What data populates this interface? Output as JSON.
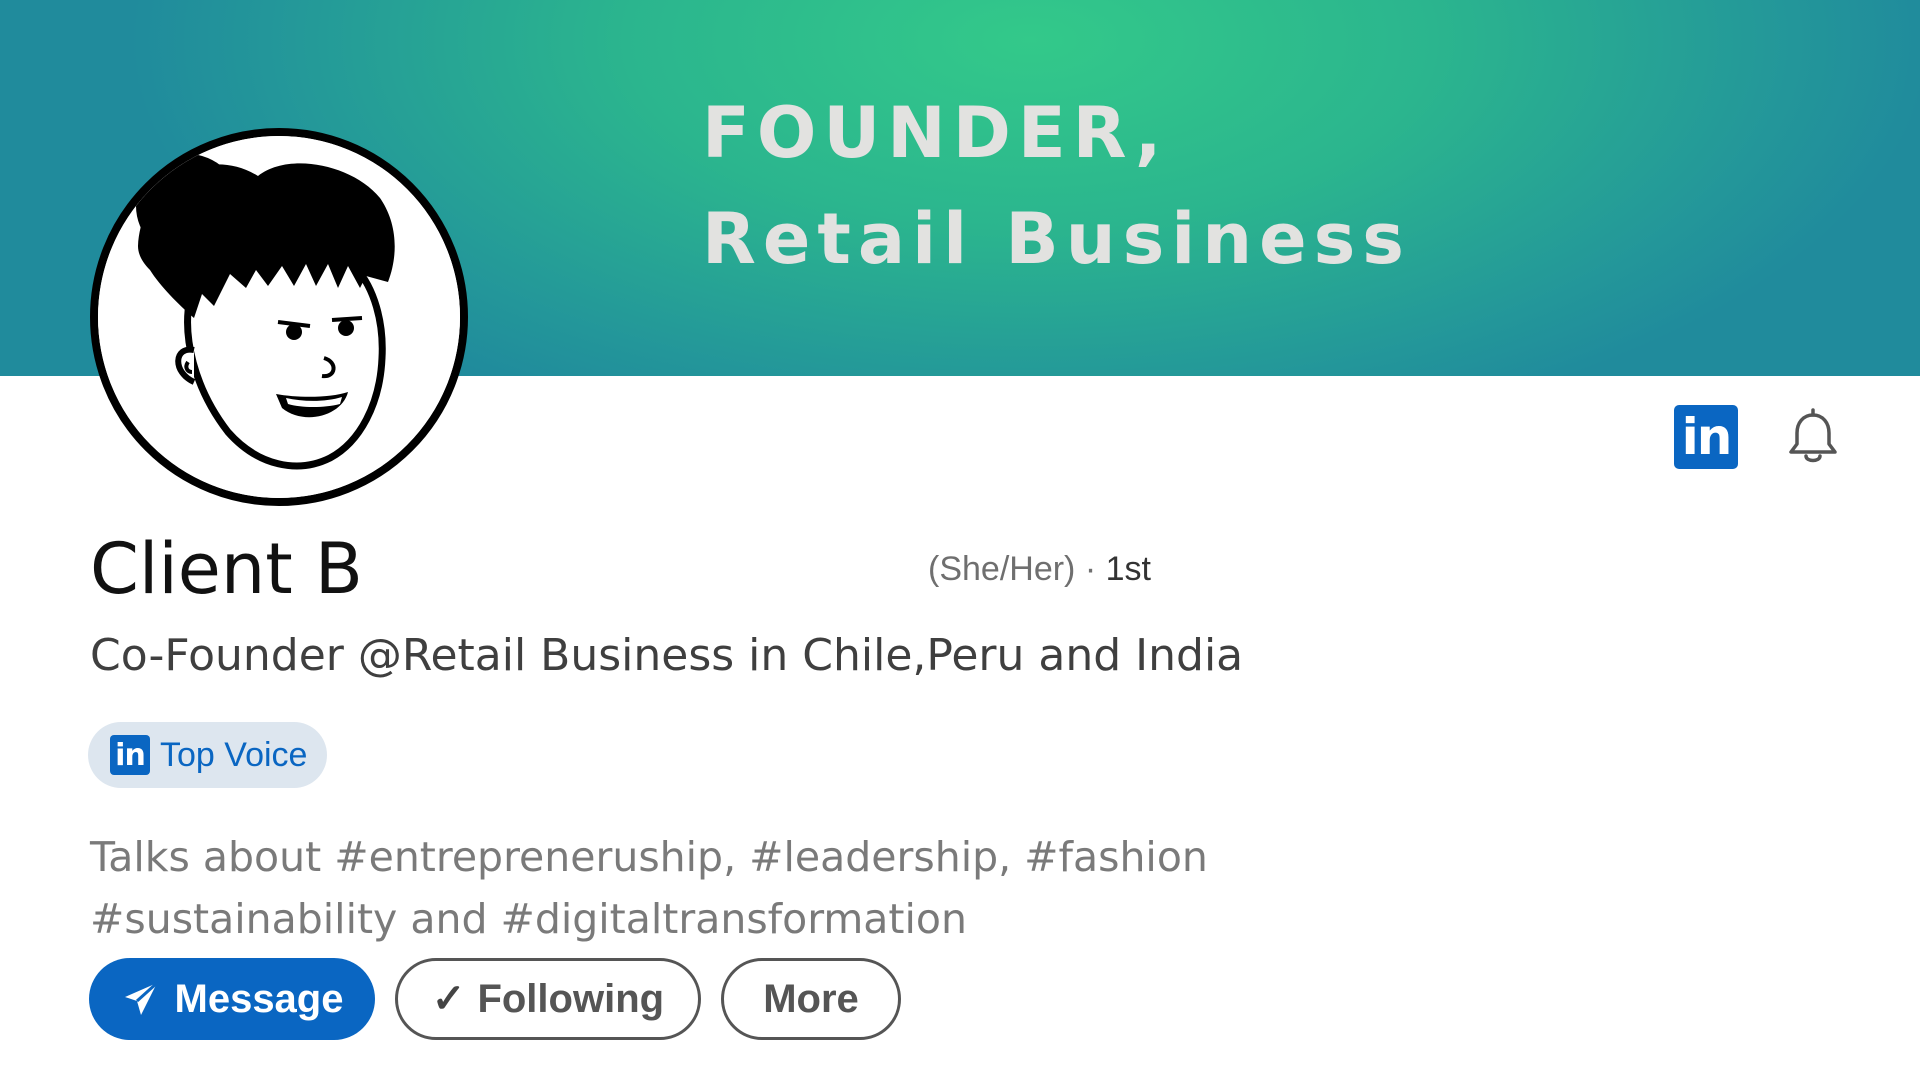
{
  "banner": {
    "line1": "FOUNDER,",
    "line2": "Retail Business"
  },
  "profile": {
    "name": "Client B",
    "pronouns": "(She/Her)",
    "separator": " · ",
    "degree": "1st",
    "headline": "Co-Founder @Retail Business in Chile,Peru and India",
    "badge": {
      "logo": "in",
      "label": "Top Voice"
    },
    "talks_about": "Talks about #entrepreneruship, #leadership, #fashion  #sustainability and #digitaltransformation"
  },
  "header_icons": {
    "linkedin_logo": "in",
    "bell_icon": "bell-icon"
  },
  "actions": {
    "message_label": "Message",
    "following_label": "Following",
    "following_check": "✓",
    "more_label": "More"
  },
  "colors": {
    "linkedin_blue": "#0a66c2",
    "banner_teal": "#23969a",
    "banner_green": "#33c98a",
    "badge_bg": "#dde6ef"
  }
}
